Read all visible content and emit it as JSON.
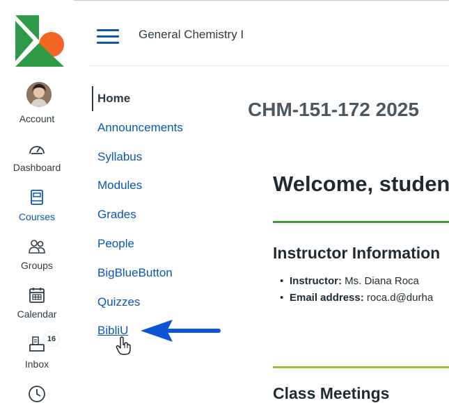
{
  "global_nav": {
    "items": [
      {
        "label": "Account",
        "icon": "avatar"
      },
      {
        "label": "Dashboard",
        "icon": "dashboard-icon"
      },
      {
        "label": "Courses",
        "icon": "courses-icon",
        "active": true
      },
      {
        "label": "Groups",
        "icon": "groups-icon"
      },
      {
        "label": "Calendar",
        "icon": "calendar-icon"
      },
      {
        "label": "Inbox",
        "icon": "inbox-icon",
        "badge": "16"
      },
      {
        "label": "",
        "icon": "history-icon"
      }
    ]
  },
  "header": {
    "breadcrumb": "General Chemistry I"
  },
  "course_nav": {
    "items": [
      {
        "label": "Home",
        "active": true
      },
      {
        "label": "Announcements"
      },
      {
        "label": "Syllabus"
      },
      {
        "label": "Modules"
      },
      {
        "label": "Grades"
      },
      {
        "label": "People"
      },
      {
        "label": "BigBlueButton"
      },
      {
        "label": "Quizzes"
      },
      {
        "label": "BibliU",
        "hover": true
      }
    ]
  },
  "content": {
    "course_code": "CHM-151-172 2025",
    "welcome": "Welcome, student",
    "instructor_heading": "Instructor Information",
    "instructor_label": "Instructor:",
    "instructor_value": " Ms. Diana Roca",
    "email_label": "Email address:",
    "email_value": " roca.d@durha",
    "class_heading": "Class Meetings"
  },
  "colors": {
    "link": "#0b57b4",
    "text": "#2d3b45",
    "logo_green": "#2e9a47",
    "logo_orange": "#f26522",
    "rule_green": "#3a9a3a",
    "rule_lime": "#98c33a",
    "arrow": "#0c55d6"
  }
}
